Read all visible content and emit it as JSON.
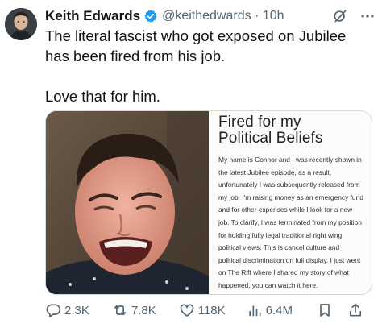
{
  "tweet": {
    "author_name": "Keith Edwards",
    "handle": "@keithedwards",
    "separator": "·",
    "time": "10h",
    "text_lines": [
      "The literal fascist who got exposed on Jubilee",
      "has been fired from his job.",
      "Love that for him."
    ]
  },
  "media": {
    "title_line1": "Fired for my",
    "title_line2": "Political Beliefs",
    "body": "My name is Connor and I was recently shown in the latest Jubilee episode, as a result, unfortunately I was subsequently released from my job. I'm raising money as an emergency fund and for other expenses while I look for a new job. To clarify, I was terminated from my position for holding fully legal traditional right wing political views. This is cancel culture and political discrimination on full display. I just went on The Rift where I shared my story of what happened, you can watch it here."
  },
  "actions": {
    "replies": "2.3K",
    "retweets": "7.8K",
    "likes": "118K",
    "views": "6.4M"
  },
  "colors": {
    "text": "#0f1419",
    "muted": "#536471",
    "verified": "#1d9bf0",
    "border": "#cfd9de"
  },
  "icons": [
    "verified-badge-icon",
    "grok-icon",
    "more-icon",
    "reply-icon",
    "retweet-icon",
    "like-icon",
    "views-icon",
    "bookmark-icon",
    "share-icon"
  ]
}
